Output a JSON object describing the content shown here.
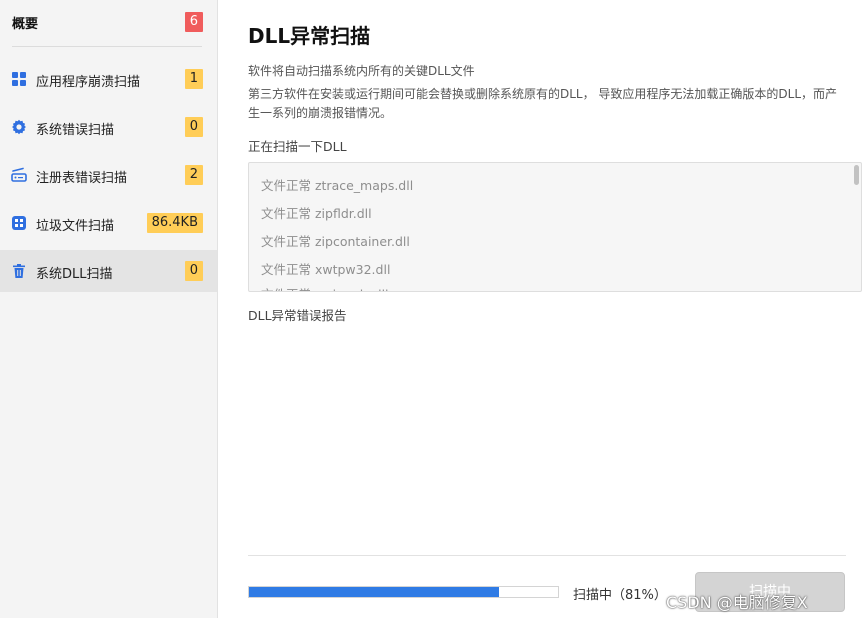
{
  "sidebar": {
    "header": {
      "title": "概要",
      "count": "6"
    },
    "items": [
      {
        "label": "应用程序崩溃扫描",
        "count": "1",
        "icon": "grid-icon"
      },
      {
        "label": "系统错误扫描",
        "count": "0",
        "icon": "gear-icon"
      },
      {
        "label": "注册表错误扫描",
        "count": "2",
        "icon": "router-icon"
      },
      {
        "label": "垃圾文件扫描",
        "count": "86.4KB",
        "icon": "apps-icon"
      },
      {
        "label": "系统DLL扫描",
        "count": "0",
        "icon": "trash-icon",
        "active": true
      }
    ]
  },
  "main": {
    "title": "DLL异常扫描",
    "desc1": "软件将自动扫描系统内所有的关键DLL文件",
    "desc2": "第三方软件在安装或运行期间可能会替换或删除系统原有的DLL， 导致应用程序无法加载正确版本的DLL，而产生一系列的崩溃报错情况。",
    "scanning_label": "正在扫描一下DLL",
    "scan_log": [
      "文件正常 ztrace_maps.dll",
      "文件正常 zipfldr.dll",
      "文件正常 zipcontainer.dll",
      "文件正常 xwtpw32.dll",
      "文件正常 xwizards.dll"
    ],
    "report_label": "DLL异常错误报告"
  },
  "footer": {
    "progress": 0.81,
    "status": "扫描中（81%）",
    "button": "扫描中",
    "watermark": "CSDN @电脑修复X"
  },
  "colors": {
    "accent": "#2f7be5",
    "badge_yellow": "#ffcd57",
    "badge_red": "#f05c5c",
    "icon_blue": "#2f6fe0"
  }
}
